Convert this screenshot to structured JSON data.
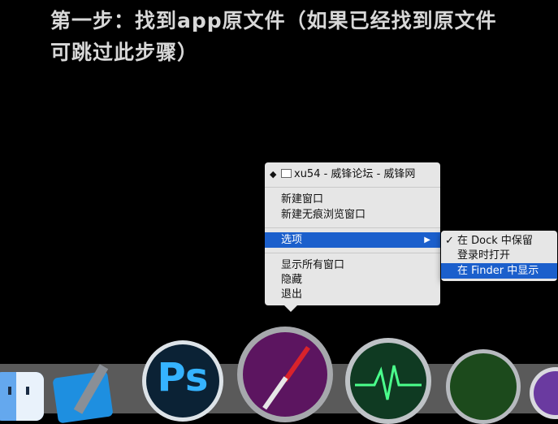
{
  "heading": {
    "line1": "第一步：找到app原文件（如果已经找到原文件",
    "line2": "可跳过此步骤）"
  },
  "context_menu": {
    "window_item": "xu54 - 威锋论坛 - 威锋网",
    "new_window": "新建窗口",
    "new_private_window": "新建无痕浏览窗口",
    "options": "选项",
    "show_all_windows": "显示所有窗口",
    "hide": "隐藏",
    "quit": "退出"
  },
  "submenu": {
    "keep_in_dock": "在 Dock 中保留",
    "open_at_login": "登录时打开",
    "show_in_finder": "在 Finder 中显示",
    "check_mark": "✓"
  },
  "dock": {
    "apps": [
      "finder",
      "xcode",
      "photoshop",
      "safari",
      "activity-monitor",
      "console",
      "siri"
    ],
    "ps_label": "Ps"
  },
  "colors": {
    "highlight": "#1b5fcc",
    "menu_bg": "#e6e6e6",
    "heading": "#d8d8d8"
  }
}
